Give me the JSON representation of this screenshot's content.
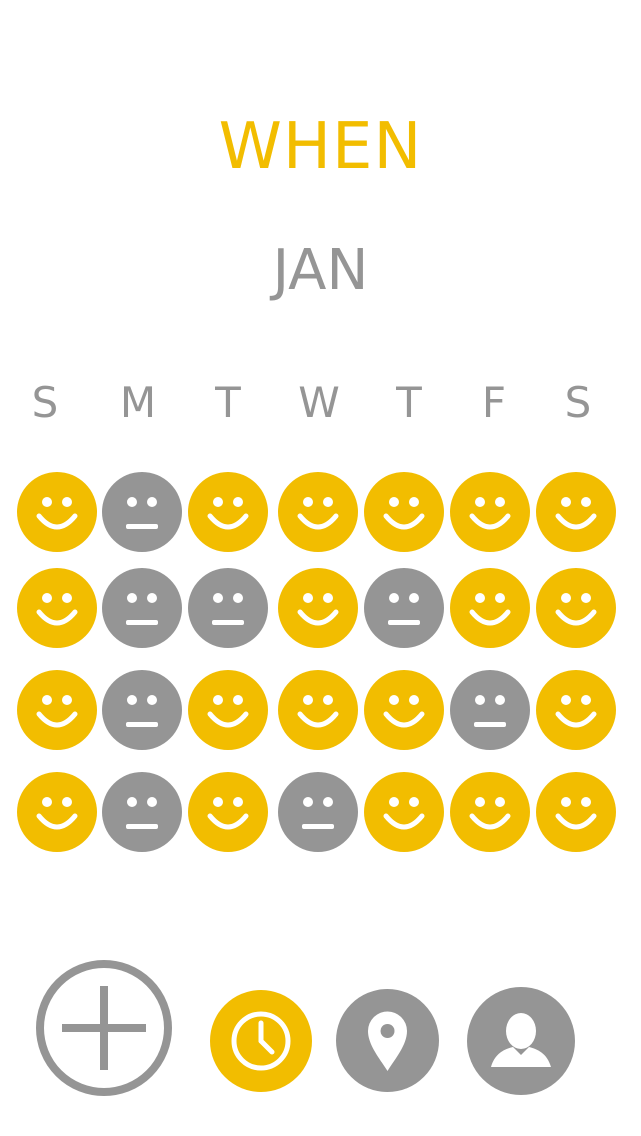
{
  "header": {
    "title": "WHEN",
    "month": "JAN"
  },
  "weekdays": [
    "S",
    "M",
    "T",
    "W",
    "T",
    "F",
    "S"
  ],
  "mood_grid": [
    [
      "happy",
      "neutral",
      "happy",
      "happy",
      "happy",
      "happy",
      "happy"
    ],
    [
      "happy",
      "neutral",
      "neutral",
      "happy",
      "neutral",
      "happy",
      "happy"
    ],
    [
      "happy",
      "neutral",
      "happy",
      "happy",
      "happy",
      "neutral",
      "happy"
    ],
    [
      "happy",
      "neutral",
      "happy",
      "neutral",
      "happy",
      "happy",
      "happy"
    ]
  ],
  "colors": {
    "accent": "#f2bd00",
    "gray": "#959595",
    "background": "#ffffff"
  },
  "toolbar": {
    "items": [
      {
        "icon": "plus-icon",
        "active": false
      },
      {
        "icon": "clock-icon",
        "active": true
      },
      {
        "icon": "location-pin-icon",
        "active": false
      },
      {
        "icon": "person-icon",
        "active": false
      }
    ]
  }
}
